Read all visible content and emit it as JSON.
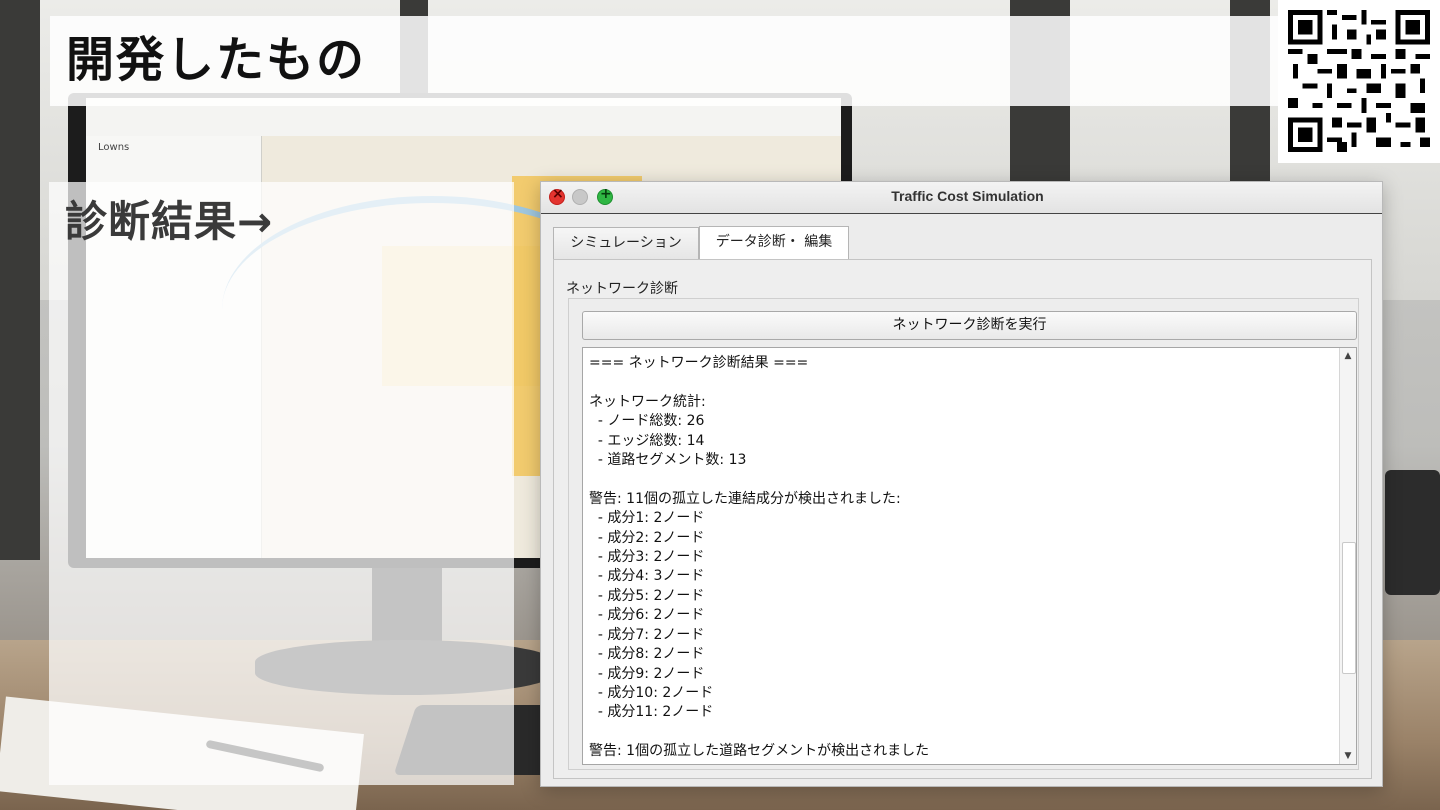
{
  "slide": {
    "title": "開発したもの",
    "left_label": "診断結果→"
  },
  "background": {
    "gis_panel_title": "Lowns"
  },
  "window": {
    "title": "Traffic Cost Simulation",
    "tabs": [
      {
        "label": "シミュレーション",
        "active": false
      },
      {
        "label": "データ診断・ 編集",
        "active": true
      }
    ],
    "group_label": "ネットワーク診断",
    "run_button": "ネットワーク診断を実行",
    "output_lines": [
      "=== ネットワーク診断結果 ===",
      "",
      "ネットワーク統計:",
      "  - ノード総数: 26",
      "  - エッジ総数: 14",
      "  - 道路セグメント数: 13",
      "",
      "警告: 11個の孤立した連結成分が検出されました:",
      "  - 成分1: 2ノード",
      "  - 成分2: 2ノード",
      "  - 成分3: 2ノード",
      "  - 成分4: 3ノード",
      "  - 成分5: 2ノード",
      "  - 成分6: 2ノード",
      "  - 成分7: 2ノード",
      "  - 成分8: 2ノード",
      "  - 成分9: 2ノード",
      "  - 成分10: 2ノード",
      "  - 成分11: 2ノード",
      "",
      "警告: 1個の孤立した道路セグメントが検出されました"
    ],
    "scroll_position": 0.7
  },
  "icons": [
    "close-icon",
    "minimize-icon",
    "maximize-icon",
    "scroll-up-arrow-icon",
    "scroll-down-arrow-icon",
    "qr-code-icon"
  ]
}
